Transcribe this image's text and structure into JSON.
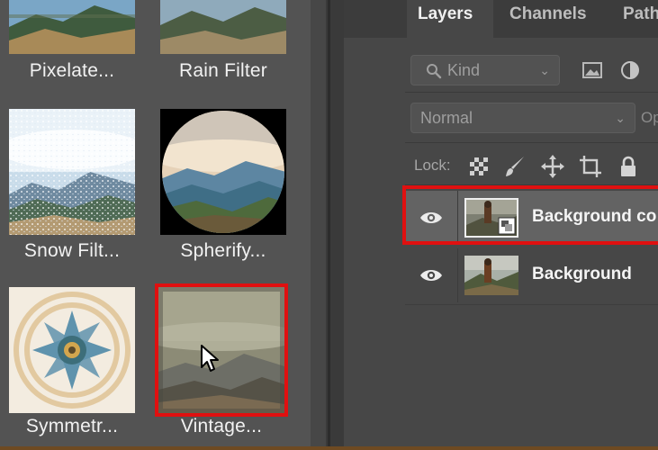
{
  "gallery": {
    "filters": [
      {
        "label": "Pixelate..."
      },
      {
        "label": "Rain Filter"
      },
      {
        "label": "Snow Filt..."
      },
      {
        "label": "Spherify..."
      },
      {
        "label": "Symmetr..."
      },
      {
        "label": "Vintage..."
      }
    ],
    "selected": "Vintage..."
  },
  "layers_panel": {
    "tabs": [
      {
        "label": "Layers",
        "active": true
      },
      {
        "label": "Channels",
        "active": false
      },
      {
        "label": "Path",
        "active": false
      }
    ],
    "filter": {
      "kind_label": "Kind"
    },
    "blend_mode": "Normal",
    "opacity_label": "Op",
    "lock_label": "Lock:",
    "layers": [
      {
        "name": "Background co",
        "selected": true,
        "visible": true,
        "smart_object": true
      },
      {
        "name": "Background",
        "selected": false,
        "visible": true,
        "smart_object": false
      }
    ]
  },
  "colors": {
    "selection_red": "#e01010",
    "panel_bg": "#474747",
    "gallery_bg": "#535353"
  }
}
